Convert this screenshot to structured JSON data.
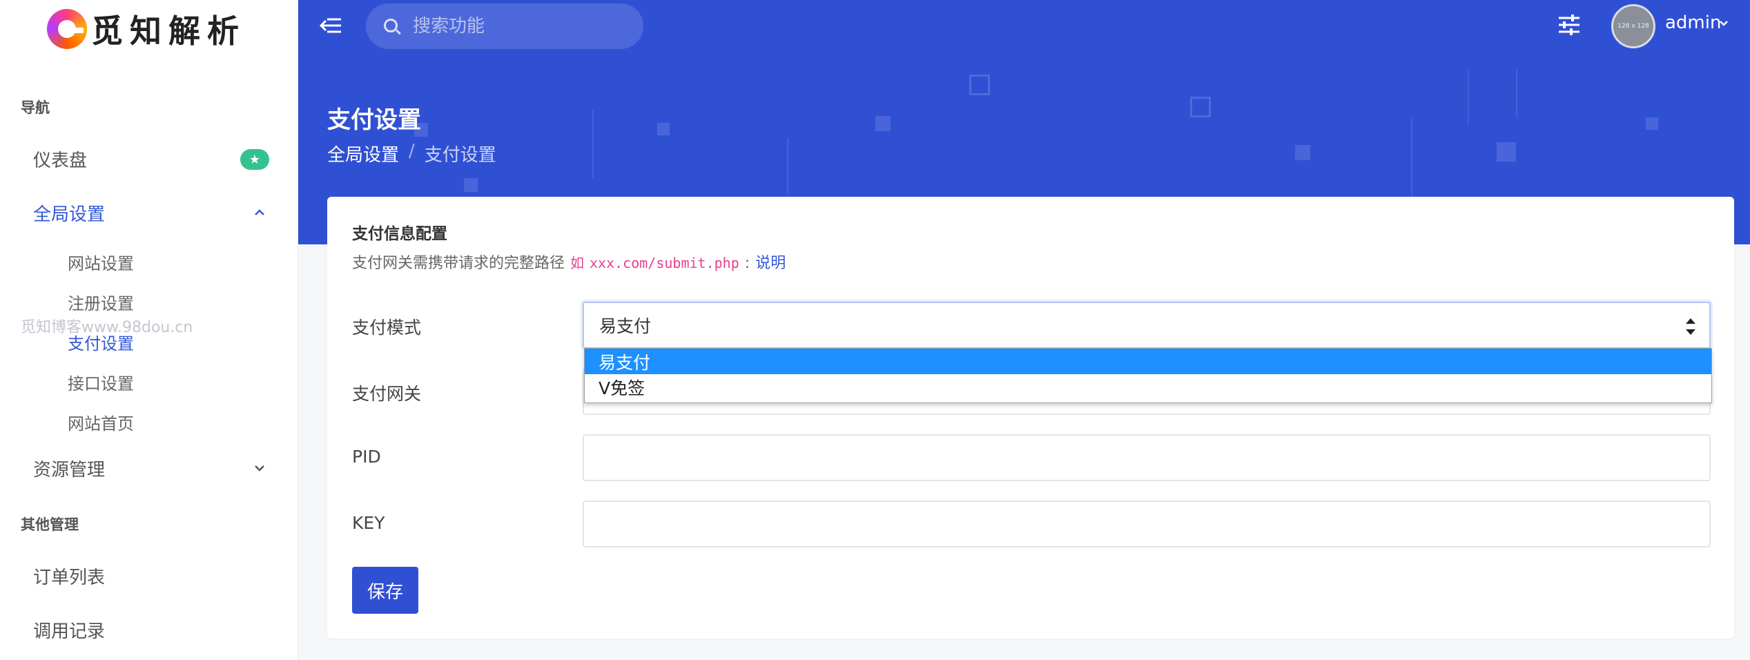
{
  "brand": {
    "logo_text": "觅知解析"
  },
  "sidebar": {
    "heading_nav": "导航",
    "dashboard": "仪表盘",
    "dashboard_badge": "★",
    "global_settings": "全局设置",
    "sub_items": [
      "网站设置",
      "注册设置",
      "支付设置",
      "接口设置",
      "网站首页"
    ],
    "resource_mgmt": "资源管理",
    "heading_other": "其他管理",
    "orders": "订单列表",
    "call_logs": "调用记录",
    "watermark": "觅知博客www.98dou.cn"
  },
  "topbar": {
    "search_placeholder": "搜索功能",
    "avatar_text": "128 x 128",
    "user_name": "admin"
  },
  "page": {
    "title": "支付设置",
    "breadcrumb": [
      "全局设置",
      "/",
      "支付设置"
    ]
  },
  "card": {
    "title": "支付信息配置",
    "desc_prefix": "支付网关需携带请求的完整路径",
    "desc_ex": "如",
    "desc_code": "xxx.com/submit.php",
    "desc_colon": ":",
    "desc_link": "说明",
    "fields": {
      "mode_label": "支付模式",
      "mode_value": "易支付",
      "gateway_label": "支付网关",
      "pid_label": "PID",
      "key_label": "KEY"
    },
    "dropdown_options": [
      "易支付",
      "V免签"
    ],
    "save_label": "保存"
  },
  "colors": {
    "brand_blue": "#3050d4",
    "link": "#3358d6",
    "badge_green": "#34c38f",
    "code_pink": "#e83e8c",
    "option_highlight": "#1e90ff"
  }
}
